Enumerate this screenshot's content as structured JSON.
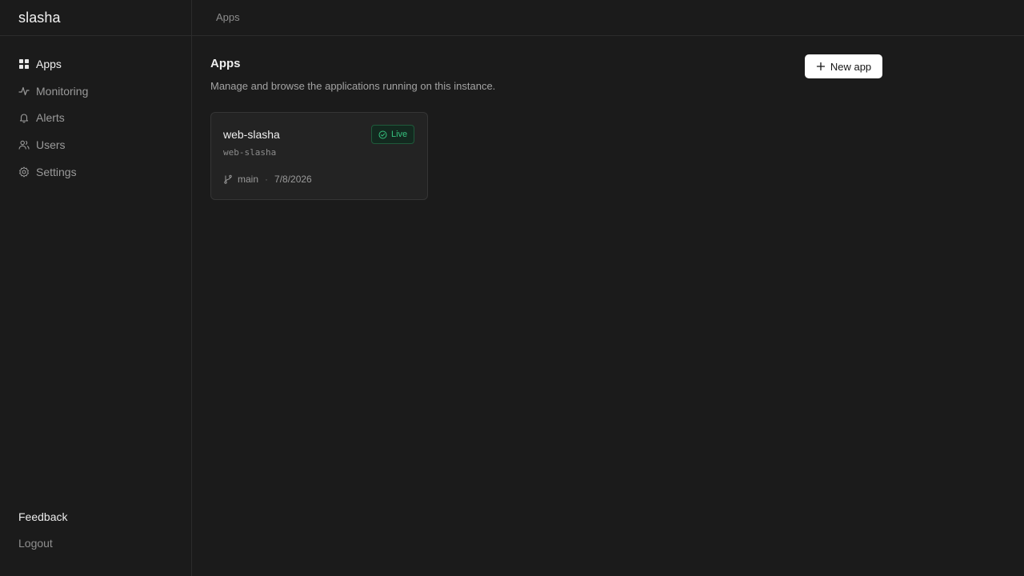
{
  "sidebar": {
    "brand": "slasha",
    "items": [
      {
        "label": "Apps",
        "icon": "grid-icon",
        "active": true
      },
      {
        "label": "Monitoring",
        "icon": "activity-icon",
        "active": false
      },
      {
        "label": "Alerts",
        "icon": "bell-icon",
        "active": false
      },
      {
        "label": "Users",
        "icon": "users-icon",
        "active": false
      },
      {
        "label": "Settings",
        "icon": "gear-icon",
        "active": false
      }
    ],
    "footer": {
      "feedback": "Feedback",
      "logout": "Logout"
    }
  },
  "topbar": {
    "breadcrumb": "Apps"
  },
  "main": {
    "title": "Apps",
    "subtitle": "Manage and browse the applications running on this instance.",
    "new_app_label": "New app",
    "apps": [
      {
        "name": "web-slasha",
        "slug": "web-slasha",
        "status": "Live",
        "branch": "main",
        "date": "7/8/2026"
      }
    ]
  },
  "colors": {
    "background": "#1b1b1b",
    "status_live": "#36c27e",
    "button_bg": "#ffffff"
  }
}
